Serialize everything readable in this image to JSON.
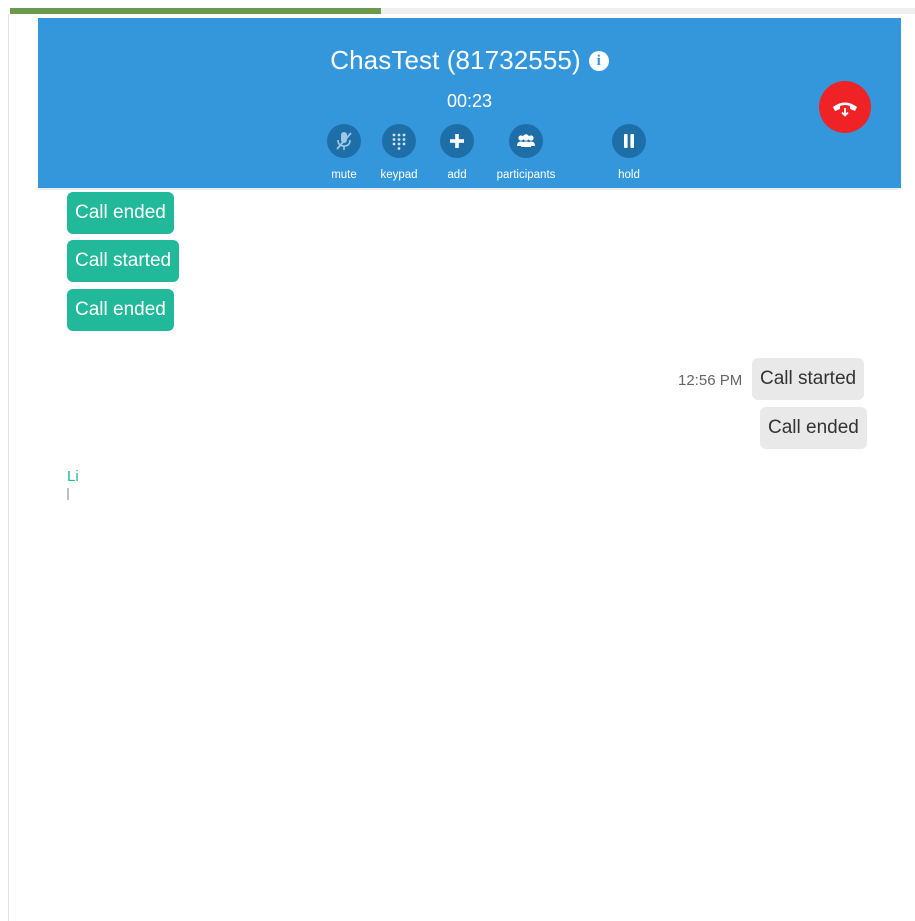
{
  "progress": {
    "fraction": 0.41
  },
  "header": {
    "contact_name": "ChasTest (81732555)",
    "timer": "00:23",
    "info_icon": "info-icon",
    "hangup_icon": "hangup-phone-icon",
    "colors": {
      "background": "#3497dc",
      "hangup": "#ef2326",
      "control": "#1e6fa8"
    }
  },
  "controls": [
    {
      "label": "mute",
      "icon": "microphone-muted-icon"
    },
    {
      "label": "keypad",
      "icon": "keypad-icon"
    },
    {
      "label": "add",
      "icon": "plus-icon"
    },
    {
      "label": "participants",
      "icon": "participants-icon"
    },
    {
      "label": "hold",
      "icon": "pause-icon"
    }
  ],
  "messages": {
    "incoming": [
      {
        "text": "Call ended"
      },
      {
        "text": "Call started"
      },
      {
        "text": "Call ended"
      }
    ],
    "outgoing": [
      {
        "time": "12:56 PM",
        "text": "Call started"
      },
      {
        "text": "Call ended"
      }
    ],
    "partial_sender_text": "Li",
    "colors": {
      "incoming": "#21b99a",
      "outgoing": "#e9e9ea"
    }
  }
}
